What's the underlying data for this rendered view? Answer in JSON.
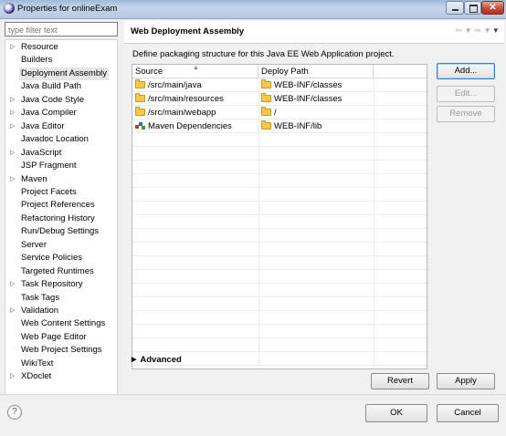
{
  "window": {
    "title": "Properties for onlineExam"
  },
  "filter": {
    "placeholder": "type filter text"
  },
  "nav": {
    "items": [
      {
        "label": "Resource",
        "expandable": true
      },
      {
        "label": "Builders",
        "expandable": false
      },
      {
        "label": "Deployment Assembly",
        "expandable": false,
        "selected": true
      },
      {
        "label": "Java Build Path",
        "expandable": false
      },
      {
        "label": "Java Code Style",
        "expandable": true
      },
      {
        "label": "Java Compiler",
        "expandable": true
      },
      {
        "label": "Java Editor",
        "expandable": true
      },
      {
        "label": "Javadoc Location",
        "expandable": false
      },
      {
        "label": "JavaScript",
        "expandable": true
      },
      {
        "label": "JSP Fragment",
        "expandable": false
      },
      {
        "label": "Maven",
        "expandable": true
      },
      {
        "label": "Project Facets",
        "expandable": false
      },
      {
        "label": "Project References",
        "expandable": false
      },
      {
        "label": "Refactoring History",
        "expandable": false
      },
      {
        "label": "Run/Debug Settings",
        "expandable": false
      },
      {
        "label": "Server",
        "expandable": false
      },
      {
        "label": "Service Policies",
        "expandable": false
      },
      {
        "label": "Targeted Runtimes",
        "expandable": false
      },
      {
        "label": "Task Repository",
        "expandable": true
      },
      {
        "label": "Task Tags",
        "expandable": false
      },
      {
        "label": "Validation",
        "expandable": true
      },
      {
        "label": "Web Content Settings",
        "expandable": false
      },
      {
        "label": "Web Page Editor",
        "expandable": false
      },
      {
        "label": "Web Project Settings",
        "expandable": false
      },
      {
        "label": "WikiText",
        "expandable": false
      },
      {
        "label": "XDoclet",
        "expandable": true
      }
    ]
  },
  "page": {
    "title": "Web Deployment Assembly",
    "description": "Define packaging structure for this Java EE Web Application project."
  },
  "table": {
    "headers": {
      "source": "Source",
      "deploy": "Deploy Path"
    },
    "rows": [
      {
        "source": "/src/main/java",
        "deploy": "WEB-INF/classes",
        "icon": "folder-icon"
      },
      {
        "source": "/src/main/resources",
        "deploy": "WEB-INF/classes",
        "icon": "folder-icon"
      },
      {
        "source": "/src/main/webapp",
        "deploy": "/",
        "icon": "folder-icon"
      },
      {
        "source": "Maven Dependencies",
        "deploy": "WEB-INF/lib",
        "icon": "library-icon"
      }
    ]
  },
  "buttons": {
    "add": "Add...",
    "edit": "Edit...",
    "remove": "Remove",
    "revert": "Revert",
    "apply": "Apply",
    "ok": "OK",
    "cancel": "Cancel"
  },
  "advanced": {
    "label": "Advanced"
  },
  "help": {
    "symbol": "?"
  }
}
